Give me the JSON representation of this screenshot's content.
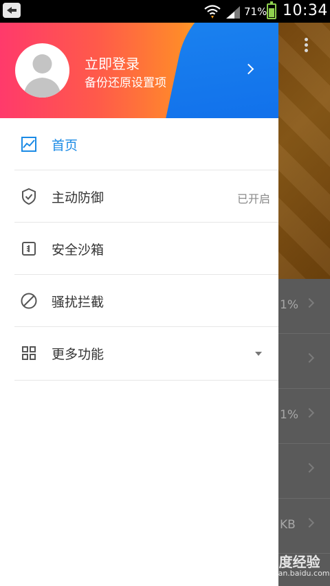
{
  "status_bar": {
    "battery_percent": "71%",
    "time": "10:34",
    "icons": [
      "back-icon",
      "wifi-icon",
      "signal-icon",
      "battery-icon"
    ]
  },
  "drawer": {
    "header": {
      "login_title": "立即登录",
      "login_subtitle": "备份还原设置项"
    },
    "items": [
      {
        "label": "首页",
        "icon": "chart-icon",
        "active": true
      },
      {
        "label": "主动防御",
        "icon": "shield-check-icon",
        "status": "已开启"
      },
      {
        "label": "安全沙箱",
        "icon": "sandbox-icon"
      },
      {
        "label": "骚扰拦截",
        "icon": "block-icon"
      },
      {
        "label": "更多功能",
        "icon": "grid-icon",
        "expandable": true
      }
    ],
    "colors": {
      "accent": "#1a8ae5",
      "header_gradient": [
        "#ff3a6b",
        "#ff8a2a",
        "#ffc21a",
        "#1e88f0"
      ]
    }
  },
  "background_app": {
    "row_values": [
      "1%",
      "",
      "1%",
      "",
      "KB"
    ]
  },
  "watermark": {
    "text": "Bai度经验",
    "url": "jingyan.baidu.com"
  }
}
